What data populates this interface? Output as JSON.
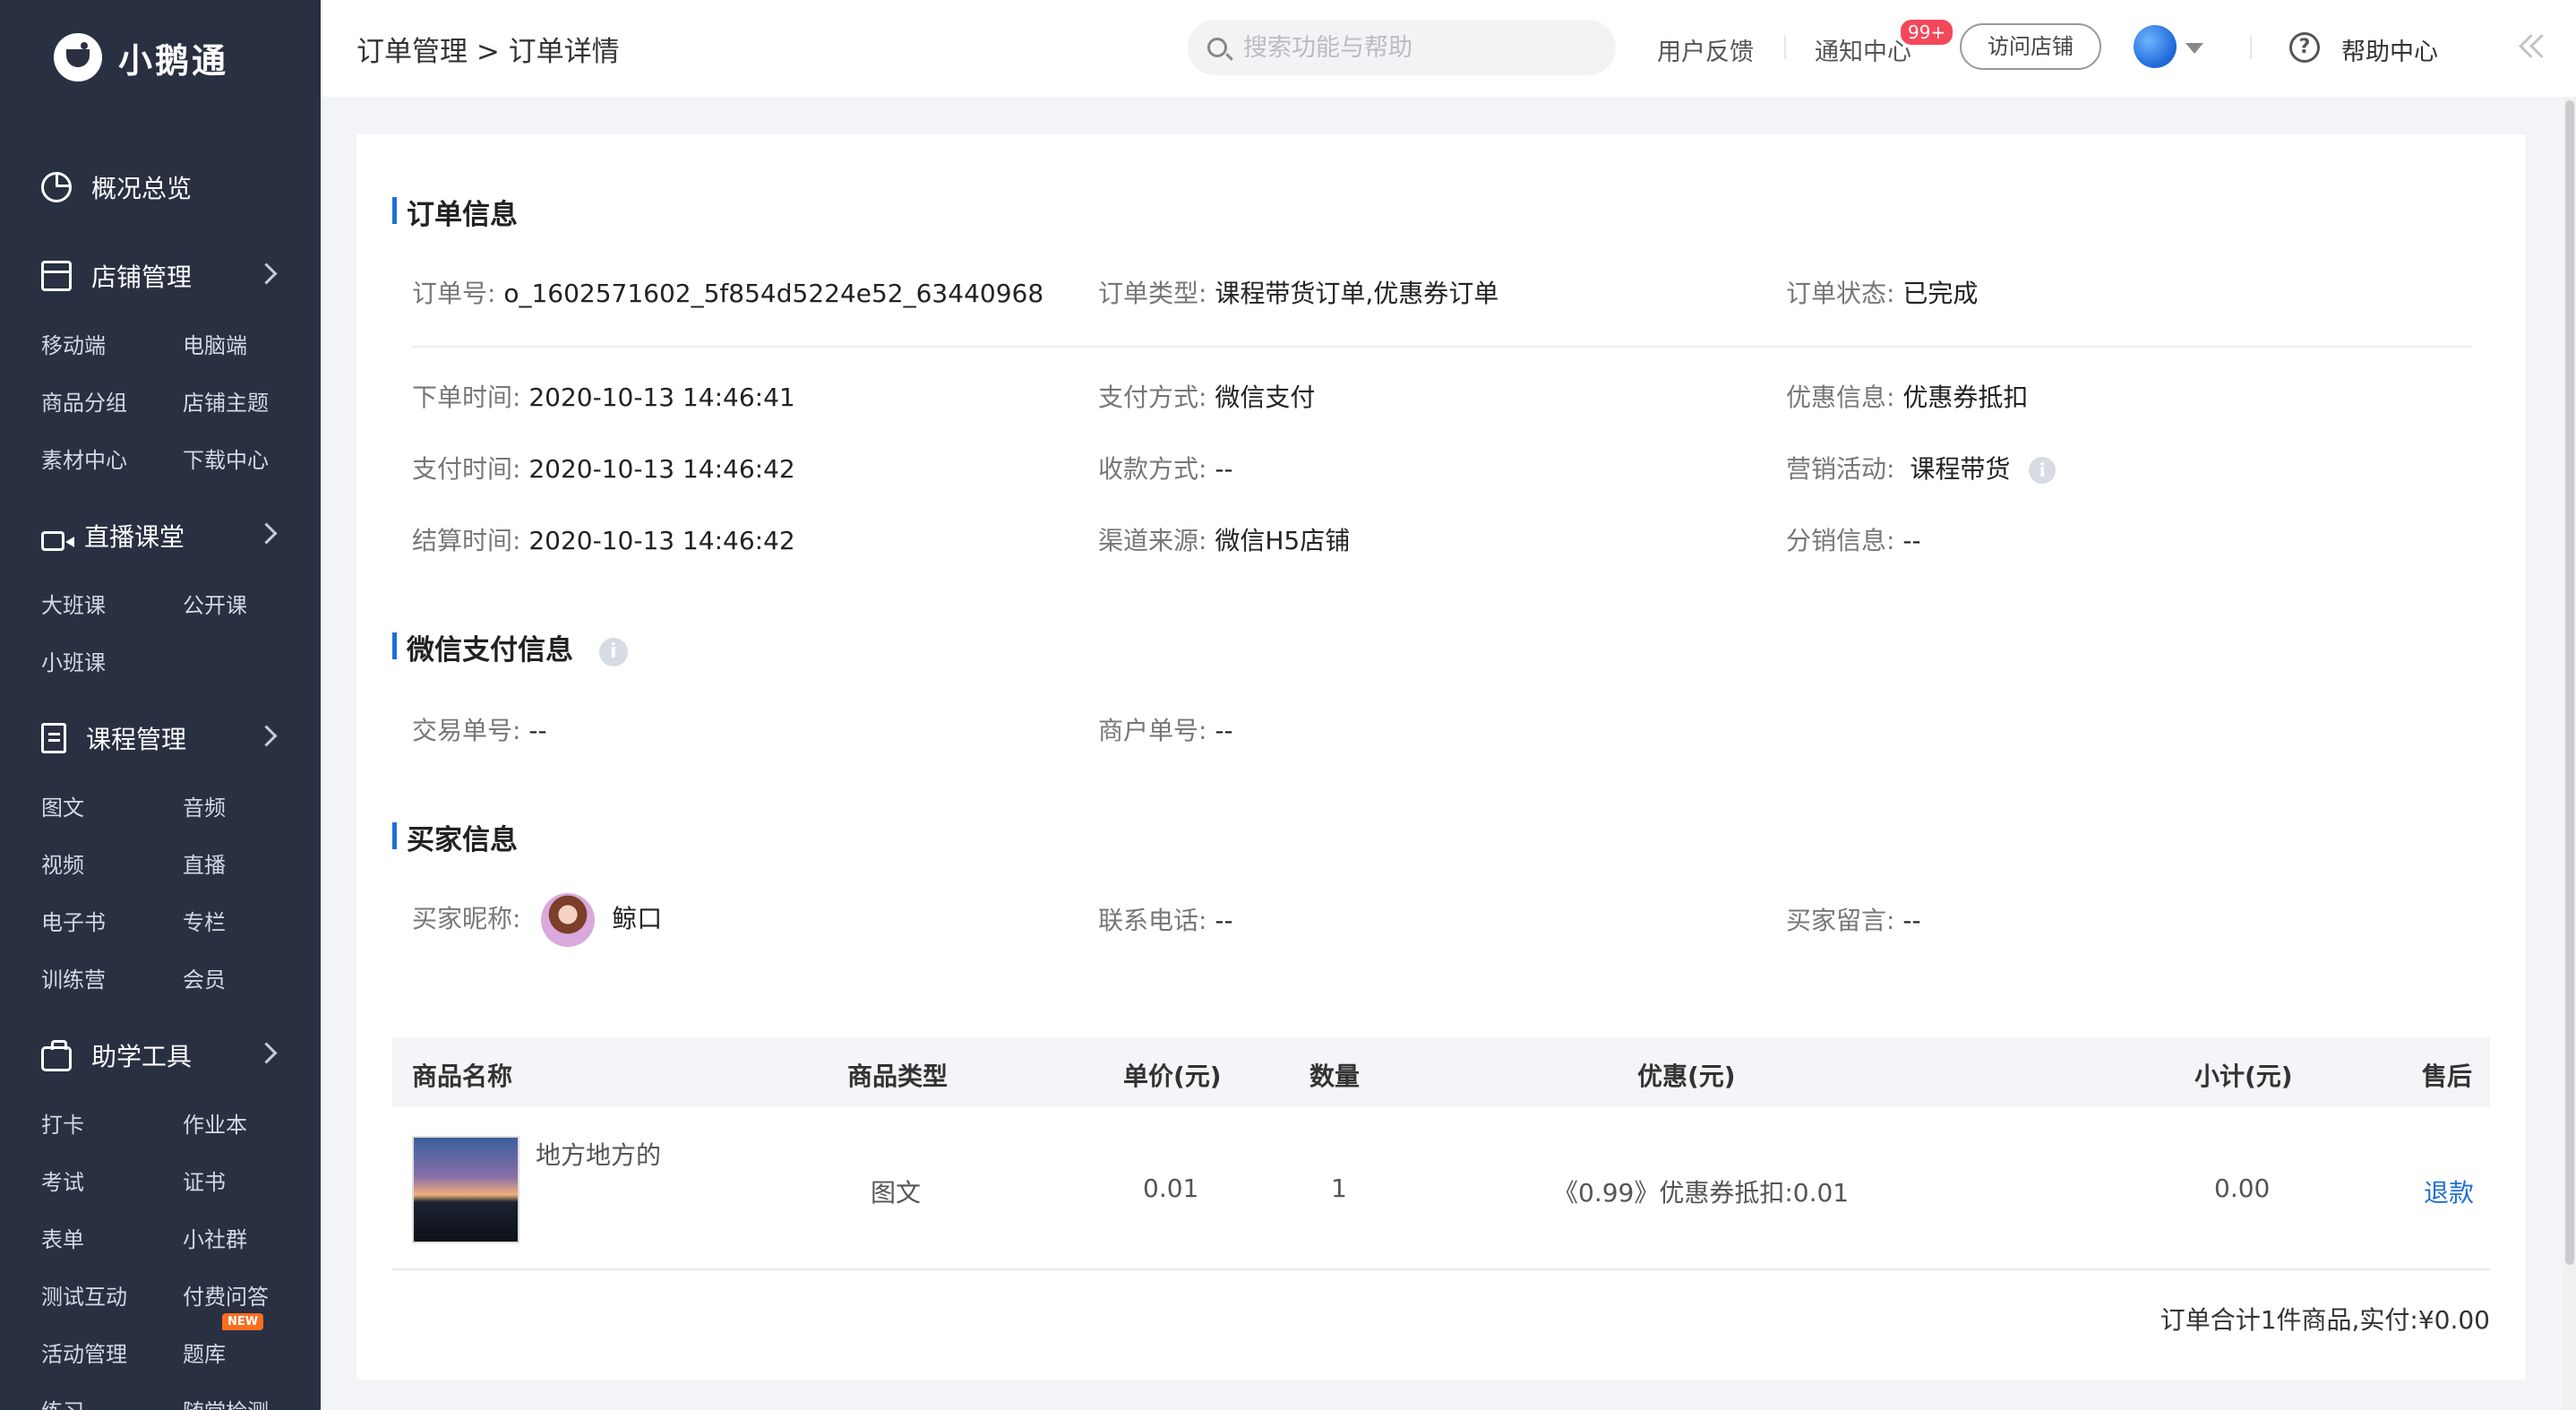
{
  "brand": {
    "name": "小鹅通"
  },
  "sidebar": {
    "overview": "概况总览",
    "groups": [
      {
        "title": "店铺管理",
        "items": [
          "移动端",
          "电脑端",
          "商品分组",
          "店铺主题",
          "素材中心",
          "下载中心"
        ]
      },
      {
        "title": "直播课堂",
        "items": [
          "大班课",
          "公开课",
          "小班课"
        ]
      },
      {
        "title": "课程管理",
        "items": [
          "图文",
          "音频",
          "视频",
          "直播",
          "电子书",
          "专栏",
          "训练营",
          "会员"
        ]
      },
      {
        "title": "助学工具",
        "items": [
          "打卡",
          "作业本",
          "考试",
          "证书",
          "表单",
          "小社群",
          "测试互动",
          "付费问答",
          "活动管理",
          "题库",
          "练习",
          "随堂检测"
        ]
      }
    ],
    "new_badge": "NEW"
  },
  "header": {
    "breadcrumb": "订单管理 > 订单详情",
    "search_placeholder": "搜索功能与帮助",
    "feedback": "用户反馈",
    "notifications": "通知中心",
    "notification_count": "99+",
    "visit_store": "访问店铺",
    "help_center": "帮助中心"
  },
  "order_info": {
    "title": "订单信息",
    "order_no_label": "订单号:",
    "order_no": "o_1602571602_5f854d5224e52_63440968",
    "order_type_label": "订单类型:",
    "order_type": "课程带货订单,优惠券订单",
    "status_label": "订单状态:",
    "status": "已完成",
    "order_time_label": "下单时间:",
    "order_time": "2020-10-13 14:46:41",
    "pay_method_label": "支付方式:",
    "pay_method": "微信支付",
    "discount_label": "优惠信息:",
    "discount": "优惠券抵扣",
    "pay_time_label": "支付时间:",
    "pay_time": "2020-10-13 14:46:42",
    "collect_label": "收款方式:",
    "collect": "--",
    "marketing_label": "营销活动:",
    "marketing": "课程带货",
    "settle_time_label": "结算时间:",
    "settle_time": "2020-10-13 14:46:42",
    "channel_label": "渠道来源:",
    "channel": "微信H5店铺",
    "distribution_label": "分销信息:",
    "distribution": "--"
  },
  "wechat_pay": {
    "title": "微信支付信息",
    "trade_no_label": "交易单号:",
    "trade_no": "--",
    "merchant_no_label": "商户单号:",
    "merchant_no": "--"
  },
  "buyer": {
    "title": "买家信息",
    "nickname_label": "买家昵称:",
    "nickname": "鲸口",
    "phone_label": "联系电话:",
    "phone": "--",
    "message_label": "买家留言:",
    "message": "--"
  },
  "table": {
    "headers": [
      "商品名称",
      "商品类型",
      "单价(元)",
      "数量",
      "优惠(元)",
      "小计(元)",
      "售后"
    ],
    "rows": [
      {
        "name": "地方地方的",
        "type": "图文",
        "price": "0.01",
        "qty": "1",
        "discount": "《0.99》优惠券抵扣:0.01",
        "subtotal": "0.00",
        "aftersale": "退款"
      }
    ]
  },
  "summary": "订单合计1件商品,实付:¥0.00"
}
